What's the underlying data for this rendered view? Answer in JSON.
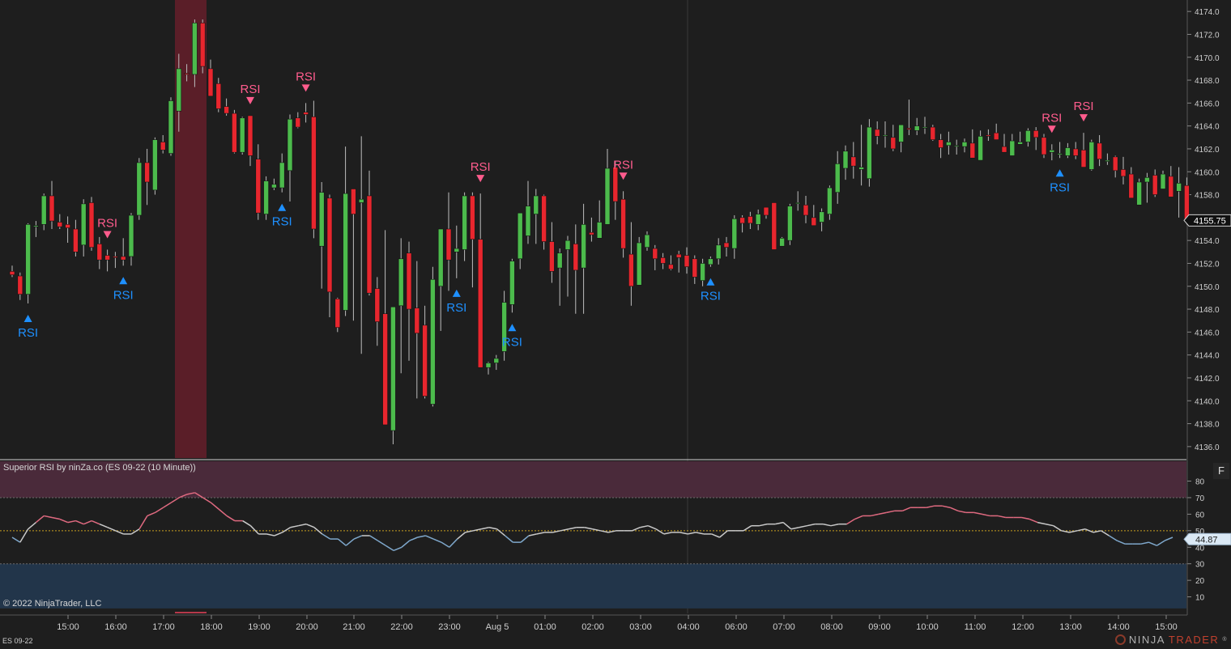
{
  "instrument": "ES 09-22",
  "indicator_title": "Superior RSI by ninZa.co (ES 09-22 (10 Minute))",
  "copyright": "© 2022 NinjaTrader, LLC",
  "panel_button": "F",
  "logo": {
    "part1": "NINJA",
    "part2": "TRADER",
    "reg": "®"
  },
  "colors": {
    "up": "#4cbb4c",
    "down": "#e8262e",
    "buy_signal": "#1e90ff",
    "sell_signal": "#ff5c8d",
    "rsi_neutral": "#c9c9c9",
    "rsi_high": "#e06a80",
    "rsi_low": "#7fa8cc",
    "overbought_zone": "#4a2a3a",
    "oversold_zone": "#22354a",
    "highlight": "#5a1e28"
  },
  "chart_data": [
    {
      "type": "candlestick",
      "ylim": [
        4135,
        4175
      ],
      "y_ticks": [
        4136,
        4138,
        4140,
        4142,
        4144,
        4146,
        4148,
        4150,
        4152,
        4154,
        4156,
        4158,
        4160,
        4162,
        4164,
        4166,
        4168,
        4170,
        4172,
        4174
      ],
      "x_labels": [
        "15:00",
        "16:00",
        "17:00",
        "18:00",
        "19:00",
        "20:00",
        "21:00",
        "22:00",
        "23:00",
        "Aug 5",
        "01:00",
        "02:00",
        "03:00",
        "04:00",
        "06:00",
        "07:00",
        "08:00",
        "09:00",
        "10:00",
        "11:00",
        "12:00",
        "13:00",
        "14:00",
        "15:00"
      ],
      "last_price": "4155.75",
      "ohlc": [
        [
          4151.3,
          4151.8,
          4150.8,
          4151.0
        ],
        [
          4150.9,
          4151.2,
          4148.8,
          4149.3
        ],
        [
          4149.3,
          4155.5,
          4148.5,
          4155.4
        ],
        [
          4155.2,
          4155.7,
          4154.3,
          4155.3
        ],
        [
          4155.4,
          4158.1,
          4154.9,
          4157.9
        ],
        [
          4157.9,
          4159.2,
          4155.0,
          4155.7
        ],
        [
          4155.6,
          4156.3,
          4155.0,
          4155.2
        ],
        [
          4155.4,
          4156.1,
          4153.8,
          4155.1
        ],
        [
          4155.0,
          4155.8,
          4152.6,
          4153.0
        ],
        [
          4153.6,
          4157.6,
          4152.6,
          4157.2
        ],
        [
          4157.3,
          4157.8,
          4153.1,
          4153.4
        ],
        [
          4153.7,
          4154.3,
          4151.5,
          4152.3
        ],
        [
          4152.7,
          4153.2,
          4151.3,
          4152.3
        ],
        [
          4152.6,
          4153.0,
          4151.6,
          4152.5
        ],
        [
          4152.6,
          4154.2,
          4151.8,
          4152.3
        ],
        [
          4152.6,
          4156.4,
          4151.8,
          4156.2
        ],
        [
          4156.2,
          4161.2,
          4155.8,
          4160.8
        ],
        [
          4160.8,
          4162.0,
          4157.1,
          4159.1
        ],
        [
          4158.4,
          4163.0,
          4158.0,
          4162.8
        ],
        [
          4162.6,
          4163.2,
          4161.6,
          4161.9
        ],
        [
          4161.6,
          4166.5,
          4161.4,
          4166.2
        ],
        [
          4165.3,
          4170.3,
          4163.5,
          4169.0
        ],
        [
          4168.6,
          4169.4,
          4167.9,
          4168.5
        ],
        [
          4168.5,
          4173.3,
          4167.4,
          4173.0
        ],
        [
          4173.0,
          4173.3,
          4168.6,
          4169.2
        ],
        [
          4169.0,
          4169.8,
          4166.8,
          4166.6
        ],
        [
          4167.7,
          4168.2,
          4165.2,
          4165.5
        ],
        [
          4165.7,
          4166.4,
          4164.9,
          4165.1
        ],
        [
          4165.1,
          4165.4,
          4161.6,
          4161.7
        ],
        [
          4161.7,
          4164.8,
          4161.5,
          4164.7
        ],
        [
          4164.9,
          4164.9,
          4160.5,
          4161.4
        ],
        [
          4161.1,
          4162.4,
          4155.8,
          4156.4
        ],
        [
          4156.3,
          4159.6,
          4155.8,
          4159.2
        ],
        [
          4158.6,
          4159.4,
          4158.4,
          4158.9
        ],
        [
          4158.6,
          4161.6,
          4158.2,
          4160.8
        ],
        [
          4160.1,
          4165.0,
          4157.4,
          4164.6
        ],
        [
          4164.7,
          4165.2,
          4163.8,
          4163.9
        ],
        [
          4165.2,
          4166.0,
          4164.3,
          4165.0
        ],
        [
          4164.8,
          4166.2,
          4154.2,
          4155.0
        ],
        [
          4153.5,
          4159.1,
          4149.8,
          4158.2
        ],
        [
          4157.7,
          4158.0,
          4147.3,
          4149.5
        ],
        [
          4148.9,
          4149.0,
          4146.0,
          4146.4
        ],
        [
          4147.9,
          4162.2,
          4147.4,
          4158.1
        ],
        [
          4158.5,
          4158.3,
          4147.0,
          4156.3
        ],
        [
          4157.3,
          4163.1,
          4144.1,
          4157.6
        ],
        [
          4157.9,
          4160.1,
          4149.2,
          4149.4
        ],
        [
          4149.8,
          4150.8,
          4144.8,
          4146.9
        ],
        [
          4147.6,
          4154.9,
          4138.0,
          4137.9
        ],
        [
          4137.4,
          4146.2,
          4136.2,
          4148.2
        ],
        [
          4148.3,
          4154.2,
          4142.4,
          4152.4
        ],
        [
          4152.9,
          4153.9,
          4143.5,
          4148.0
        ],
        [
          4148.1,
          4152.2,
          4140.2,
          4145.9
        ],
        [
          4146.6,
          4148.3,
          4140.2,
          4140.4
        ],
        [
          4139.7,
          4151.7,
          4139.5,
          4150.6
        ],
        [
          4150.0,
          4155.0,
          4146.1,
          4155.0
        ],
        [
          4155.0,
          4158.2,
          4149.6,
          4152.3
        ],
        [
          4153.0,
          4155.3,
          4150.7,
          4153.3
        ],
        [
          4153.2,
          4158.2,
          4152.2,
          4157.9
        ],
        [
          4157.9,
          4158.2,
          4149.9,
          4154.1
        ],
        [
          4154.1,
          4158.1,
          4149.1,
          4142.9
        ],
        [
          4142.9,
          4143.4,
          4142.3,
          4143.3
        ],
        [
          4143.3,
          4144.0,
          4142.7,
          4143.7
        ],
        [
          4144.3,
          4149.6,
          4143.5,
          4148.6
        ],
        [
          4148.4,
          4152.4,
          4147.7,
          4152.2
        ],
        [
          4152.4,
          4155.5,
          4151.5,
          4156.4
        ],
        [
          4154.4,
          4159.2,
          4153.7,
          4157.0
        ],
        [
          4156.3,
          4158.5,
          4153.7,
          4157.9
        ],
        [
          4157.9,
          4158.0,
          4153.2,
          4153.9
        ],
        [
          4153.9,
          4155.6,
          4150.3,
          4151.3
        ],
        [
          4151.6,
          4153.3,
          4148.3,
          4152.9
        ],
        [
          4153.2,
          4154.4,
          4149.1,
          4154.0
        ],
        [
          4153.7,
          4155.4,
          4147.6,
          4151.4
        ],
        [
          4151.6,
          4157.2,
          4147.6,
          4155.4
        ],
        [
          4154.7,
          4156.0,
          4153.9,
          4154.5
        ],
        [
          4154.2,
          4157.5,
          4154.4,
          4155.6
        ],
        [
          4155.4,
          4162.0,
          4156.4,
          4160.3
        ],
        [
          4160.4,
          4160.9,
          4155.8,
          4157.4
        ],
        [
          4157.6,
          4158.3,
          4152.5,
          4153.3
        ],
        [
          4152.8,
          4155.6,
          4148.3,
          4150.0
        ],
        [
          4150.1,
          4154.3,
          4150.1,
          4153.8
        ],
        [
          4153.4,
          4154.8,
          4153.1,
          4154.5
        ],
        [
          4153.3,
          4153.6,
          4151.4,
          4152.4
        ],
        [
          4152.5,
          4152.9,
          4151.5,
          4152.0
        ],
        [
          4151.9,
          4152.7,
          4151.4,
          4151.5
        ],
        [
          4152.8,
          4153.1,
          4151.2,
          4152.5
        ],
        [
          4152.7,
          4153.4,
          4151.1,
          4151.7
        ],
        [
          4152.4,
          4152.7,
          4150.2,
          4150.8
        ],
        [
          4150.5,
          4152.4,
          4150.0,
          4152.0
        ],
        [
          4151.9,
          4152.6,
          4151.7,
          4152.4
        ],
        [
          4152.4,
          4154.2,
          4151.9,
          4153.6
        ],
        [
          4153.8,
          4154.3,
          4152.6,
          4153.4
        ],
        [
          4153.3,
          4156.2,
          4152.4,
          4155.9
        ],
        [
          4156.0,
          4156.2,
          4154.7,
          4155.5
        ],
        [
          4156.1,
          4156.5,
          4155.0,
          4155.5
        ],
        [
          4155.4,
          4156.7,
          4154.9,
          4156.3
        ],
        [
          4156.9,
          4156.6,
          4155.9,
          4156.2
        ],
        [
          4157.3,
          4156.7,
          4154.0,
          4153.2
        ],
        [
          4153.5,
          4154.3,
          4153.7,
          4154.2
        ],
        [
          4154.0,
          4157.2,
          4153.6,
          4157.0
        ],
        [
          4157.3,
          4158.3,
          4156.6,
          4157.3
        ],
        [
          4157.1,
          4157.9,
          4155.5,
          4156.2
        ],
        [
          4156.0,
          4157.1,
          4155.7,
          4155.3
        ],
        [
          4155.6,
          4156.8,
          4154.8,
          4156.5
        ],
        [
          4156.3,
          4158.8,
          4155.8,
          4158.6
        ],
        [
          4158.2,
          4161.8,
          4157.2,
          4160.7
        ],
        [
          4160.3,
          4162.3,
          4159.3,
          4161.8
        ],
        [
          4161.3,
          4162.6,
          4159.4,
          4160.5
        ],
        [
          4160.2,
          4164.1,
          4158.8,
          4160.4
        ],
        [
          4159.4,
          4164.6,
          4158.7,
          4163.9
        ],
        [
          4163.7,
          4164.4,
          4162.4,
          4163.1
        ],
        [
          4163.2,
          4164.4,
          4162.1,
          4163.2
        ],
        [
          4163.0,
          4164.1,
          4161.8,
          4162.0
        ],
        [
          4162.6,
          4164.0,
          4161.7,
          4164.1
        ],
        [
          4163.8,
          4166.3,
          4163.2,
          4163.7
        ],
        [
          4163.6,
          4164.7,
          4163.2,
          4164.0
        ],
        [
          4163.9,
          4164.8,
          4163.3,
          4163.9
        ],
        [
          4163.9,
          4164.1,
          4162.7,
          4162.8
        ],
        [
          4162.8,
          4163.3,
          4161.2,
          4162.1
        ],
        [
          4162.3,
          4163.5,
          4161.5,
          4162.6
        ],
        [
          4162.3,
          4162.8,
          4161.5,
          4162.3
        ],
        [
          4162.2,
          4162.9,
          4161.7,
          4162.6
        ],
        [
          4162.5,
          4163.7,
          4161.9,
          4161.2
        ],
        [
          4161.0,
          4163.6,
          4161.3,
          4163.1
        ],
        [
          4163.2,
          4163.7,
          4162.7,
          4163.1
        ],
        [
          4163.4,
          4164.2,
          4162.9,
          4162.8
        ],
        [
          4162.2,
          4163.3,
          4162.2,
          4161.7
        ],
        [
          4161.4,
          4163.3,
          4161.5,
          4162.7
        ],
        [
          4162.4,
          4163.5,
          4162.6,
          4162.6
        ],
        [
          4162.6,
          4163.8,
          4162.2,
          4163.6
        ],
        [
          4163.6,
          4163.9,
          4161.9,
          4163.0
        ],
        [
          4163.0,
          4163.3,
          4161.2,
          4161.5
        ],
        [
          4161.7,
          4162.4,
          4161.0,
          4161.9
        ],
        [
          4161.5,
          4162.6,
          4161.2,
          4161.6
        ],
        [
          4161.4,
          4162.5,
          4161.2,
          4162.1
        ],
        [
          4162.0,
          4162.6,
          4161.1,
          4161.4
        ],
        [
          4161.9,
          4163.4,
          4161.4,
          4160.4
        ],
        [
          4160.2,
          4162.8,
          4160.1,
          4162.6
        ],
        [
          4162.5,
          4163.2,
          4160.5,
          4161.1
        ],
        [
          4160.9,
          4161.6,
          4160.6,
          4161.0
        ],
        [
          4161.3,
          4161.4,
          4159.5,
          4160.1
        ],
        [
          4160.2,
          4161.3,
          4158.9,
          4159.6
        ],
        [
          4159.8,
          4160.4,
          4157.8,
          4157.7
        ],
        [
          4157.1,
          4159.4,
          4157.1,
          4159.1
        ],
        [
          4159.1,
          4159.9,
          4157.3,
          4159.5
        ],
        [
          4159.7,
          4160.2,
          4157.8,
          4158.0
        ],
        [
          4158.5,
          4160.1,
          4158.5,
          4159.8
        ],
        [
          4159.6,
          4160.5,
          4158.8,
          4157.8
        ],
        [
          4158.3,
          4160.4,
          4156.0,
          4159.0
        ],
        [
          4158.8,
          4159.5,
          4155.4,
          4155.7
        ]
      ],
      "highlight_range": [
        4150.5,
        4150.5
      ],
      "signals": [
        {
          "i": 2,
          "dir": "buy",
          "text": "RSI"
        },
        {
          "i": 12,
          "dir": "sell",
          "text": "RSI"
        },
        {
          "i": 14,
          "dir": "buy",
          "text": "RSI"
        },
        {
          "i": 30,
          "dir": "sell",
          "text": "RSI"
        },
        {
          "i": 34,
          "dir": "buy",
          "text": "RSI"
        },
        {
          "i": 37,
          "dir": "sell",
          "text": "RSI"
        },
        {
          "i": 56,
          "dir": "buy",
          "text": "RSI"
        },
        {
          "i": 59,
          "dir": "sell",
          "text": "RSI"
        },
        {
          "i": 63,
          "dir": "buy",
          "text": "RSI"
        },
        {
          "i": 77,
          "dir": "sell",
          "text": "RSI"
        },
        {
          "i": 88,
          "dir": "buy",
          "text": "RSI"
        },
        {
          "i": 131,
          "dir": "sell",
          "text": "RSI"
        },
        {
          "i": 132,
          "dir": "buy",
          "text": "RSI"
        },
        {
          "i": 135,
          "dir": "sell",
          "text": "RSI"
        }
      ]
    },
    {
      "type": "line",
      "name": "Superior RSI",
      "ylim": [
        0,
        92
      ],
      "y_ticks": [
        10,
        20,
        30,
        40,
        50,
        60,
        70,
        80
      ],
      "overbought": 70,
      "oversold": 30,
      "midline": 50,
      "last_value": "44.87",
      "values": [
        46,
        43,
        51,
        55,
        59,
        58,
        57,
        55,
        56,
        54,
        56,
        54,
        52,
        50,
        48,
        48,
        51,
        59,
        61,
        64,
        67,
        70,
        72,
        73,
        70,
        67,
        63,
        59,
        56,
        56,
        53,
        48,
        48,
        47,
        49,
        52,
        53,
        54,
        52,
        48,
        45,
        45,
        41,
        45,
        47,
        47,
        44,
        41,
        38,
        40,
        44,
        46,
        47,
        45,
        43,
        40,
        45,
        49,
        50,
        51,
        52,
        51,
        47,
        43,
        43,
        47,
        48,
        49,
        49,
        50,
        51,
        52,
        52,
        51,
        50,
        49,
        50,
        50,
        50,
        52,
        53,
        51,
        48,
        49,
        49,
        48,
        49,
        48,
        48,
        46,
        50,
        50,
        50,
        53,
        53,
        54,
        54,
        55,
        51,
        52,
        53,
        54,
        54,
        53,
        54,
        54,
        57,
        59,
        59,
        60,
        61,
        62,
        62,
        64,
        64,
        64,
        65,
        65,
        64,
        62,
        61,
        61,
        60,
        59,
        59,
        58,
        58,
        58,
        57,
        55,
        54,
        53,
        50,
        49,
        50,
        51,
        49,
        50,
        47,
        44,
        42,
        42,
        42,
        43,
        41,
        44,
        46
      ]
    }
  ]
}
